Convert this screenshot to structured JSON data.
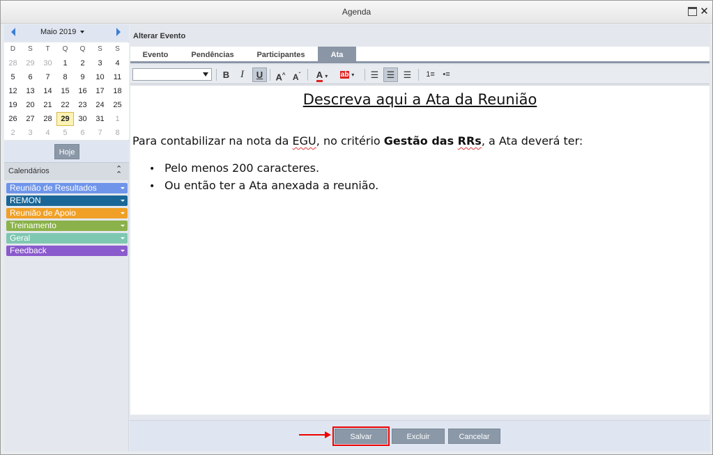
{
  "window": {
    "title": "Agenda"
  },
  "calendar": {
    "month_label": "Maio 2019",
    "weekdays": [
      "D",
      "S",
      "T",
      "Q",
      "Q",
      "S",
      "S"
    ],
    "weeks": [
      [
        {
          "d": "28",
          "other": true
        },
        {
          "d": "29",
          "other": true
        },
        {
          "d": "30",
          "other": true
        },
        {
          "d": "1"
        },
        {
          "d": "2"
        },
        {
          "d": "3"
        },
        {
          "d": "4"
        }
      ],
      [
        {
          "d": "5"
        },
        {
          "d": "6"
        },
        {
          "d": "7"
        },
        {
          "d": "8"
        },
        {
          "d": "9"
        },
        {
          "d": "10"
        },
        {
          "d": "11"
        }
      ],
      [
        {
          "d": "12"
        },
        {
          "d": "13"
        },
        {
          "d": "14"
        },
        {
          "d": "15"
        },
        {
          "d": "16"
        },
        {
          "d": "17"
        },
        {
          "d": "18"
        }
      ],
      [
        {
          "d": "19"
        },
        {
          "d": "20"
        },
        {
          "d": "21"
        },
        {
          "d": "22"
        },
        {
          "d": "23"
        },
        {
          "d": "24"
        },
        {
          "d": "25"
        }
      ],
      [
        {
          "d": "26"
        },
        {
          "d": "27"
        },
        {
          "d": "28"
        },
        {
          "d": "29",
          "today": true
        },
        {
          "d": "30"
        },
        {
          "d": "31"
        },
        {
          "d": "1",
          "other": true
        }
      ],
      [
        {
          "d": "2",
          "other": true
        },
        {
          "d": "3",
          "other": true
        },
        {
          "d": "4",
          "other": true
        },
        {
          "d": "5",
          "other": true
        },
        {
          "d": "6",
          "other": true
        },
        {
          "d": "7",
          "other": true
        },
        {
          "d": "8",
          "other": true
        }
      ]
    ],
    "today_button": "Hoje"
  },
  "calendars": {
    "header": "Calendários",
    "items": [
      {
        "label": "Reunião de Resultados",
        "color": "#6f95ea"
      },
      {
        "label": "REMON",
        "color": "#1a6797"
      },
      {
        "label": "Reunião de Apoio",
        "color": "#f0a027"
      },
      {
        "label": "Treinamento",
        "color": "#8bb24a"
      },
      {
        "label": "Geral",
        "color": "#7ec7b1"
      },
      {
        "label": "Feedback",
        "color": "#8a5bcc"
      }
    ]
  },
  "panel": {
    "title": "Alterar Evento",
    "tabs": [
      "Evento",
      "Pendências",
      "Participantes",
      "Ata"
    ],
    "active_tab": "Ata"
  },
  "toolbar": {
    "font_select_value": "",
    "tools": [
      "bold-icon",
      "italic-icon",
      "underline-icon",
      "font-grow-icon",
      "font-shrink-icon",
      "font-color-icon",
      "highlight-icon",
      "align-left-icon",
      "align-center-icon",
      "align-right-icon",
      "ordered-list-icon",
      "unordered-list-icon"
    ]
  },
  "document": {
    "title": "Descreva aqui a Ata da Reunião",
    "para_prefix": "Para contabilizar na nota da ",
    "para_egu": "EGU",
    "para_mid": ", no critério ",
    "para_bold_1": "Gestão das ",
    "para_bold_2": "RRs",
    "para_suffix": ", a Ata deverá ter:",
    "bullets": [
      "Pelo menos 200 caracteres.",
      "Ou então ter a Ata anexada a reunião."
    ]
  },
  "footer": {
    "save": "Salvar",
    "delete": "Excluir",
    "cancel": "Cancelar"
  },
  "colors": {
    "accent": "#8a96a6",
    "highlight_outline": "#e00000"
  }
}
